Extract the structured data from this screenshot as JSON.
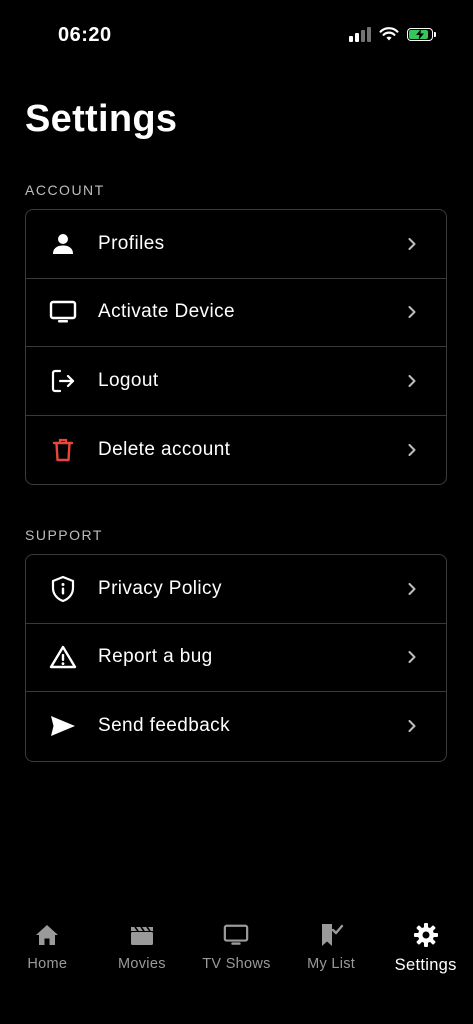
{
  "status_bar": {
    "time": "06:20",
    "battery_color": "#34c759",
    "icons": [
      "signal-icon",
      "wifi-icon",
      "battery-charging-icon"
    ]
  },
  "page": {
    "title": "Settings"
  },
  "sections": {
    "account": {
      "header": "ACCOUNT",
      "items": [
        {
          "label": "Profiles",
          "icon": "person-icon"
        },
        {
          "label": "Activate Device",
          "icon": "monitor-icon"
        },
        {
          "label": "Logout",
          "icon": "logout-icon"
        },
        {
          "label": "Delete account",
          "icon": "trash-icon",
          "icon_color": "#e5483b"
        }
      ]
    },
    "support": {
      "header": "SUPPORT",
      "items": [
        {
          "label": "Privacy Policy",
          "icon": "shield-info-icon"
        },
        {
          "label": "Report a bug",
          "icon": "warning-icon"
        },
        {
          "label": "Send feedback",
          "icon": "send-icon"
        }
      ]
    }
  },
  "tab_bar": {
    "active": "Settings",
    "active_color": "#ffffff",
    "inactive_color": "#9a9a9a",
    "tabs": [
      {
        "label": "Home",
        "icon": "home-icon"
      },
      {
        "label": "Movies",
        "icon": "clapperboard-icon"
      },
      {
        "label": "TV Shows",
        "icon": "tv-icon"
      },
      {
        "label": "My List",
        "icon": "bookmark-check-icon"
      },
      {
        "label": "Settings",
        "icon": "gear-icon"
      }
    ]
  }
}
